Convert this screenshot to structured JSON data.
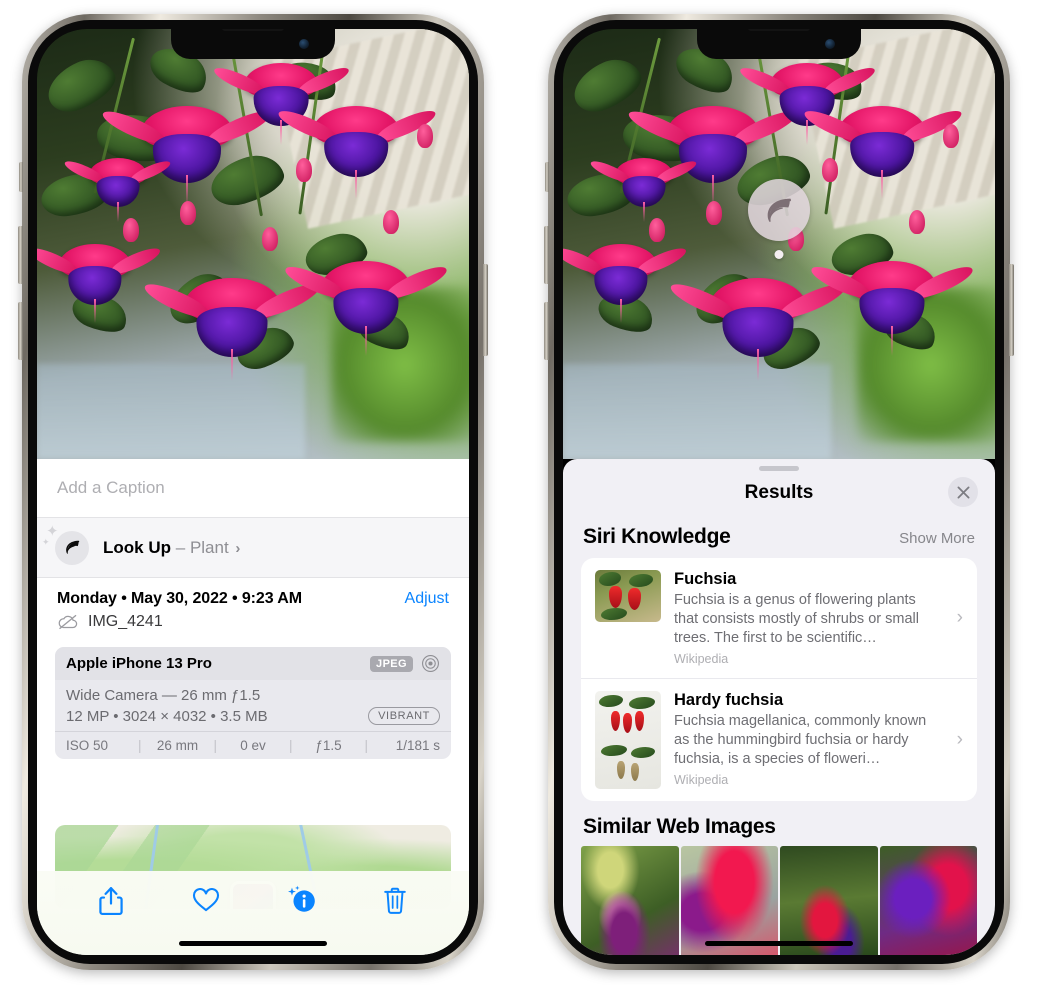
{
  "left_phone": {
    "caption_placeholder": "Add a Caption",
    "lookup": {
      "label": "Look Up",
      "dash": "–",
      "subject": "Plant",
      "chevron": "›",
      "icon": "leaf-icon"
    },
    "metadata": {
      "date_line": "Monday • May 30, 2022 • 9:23 AM",
      "adjust_label": "Adjust",
      "filename": "IMG_4241",
      "cloud_icon": "cloud-slash-icon"
    },
    "exif": {
      "device": "Apple iPhone 13 Pro",
      "format_badge": "JPEG",
      "aperture_icon": "aperture-icon",
      "lens_line": "Wide Camera — 26 mm ƒ1.5",
      "size_line": "12 MP • 3024 × 4032 • 3.5 MB",
      "style_badge": "VIBRANT",
      "stats": [
        "ISO 50",
        "26 mm",
        "0 ev",
        "ƒ1.5",
        "1/181 s"
      ],
      "divider": "|"
    },
    "toolbar": {
      "share_label": "Share",
      "favorite_label": "Favorite",
      "info_label": "Info",
      "delete_label": "Delete"
    }
  },
  "right_phone": {
    "badge_icon": "leaf-icon",
    "sheet": {
      "title": "Results",
      "close_icon": "close-icon",
      "sections": [
        {
          "title": "Siri Knowledge",
          "action": "Show More",
          "items": [
            {
              "title": "Fuchsia",
              "description": "Fuchsia is a genus of flowering plants that consists mostly of shrubs or small trees. The first to be scientific…",
              "source": "Wikipedia",
              "chevron": "›"
            },
            {
              "title": "Hardy fuchsia",
              "description": "Fuchsia magellanica, commonly known as the hummingbird fuchsia or hardy fuchsia, is a species of floweri…",
              "source": "Wikipedia",
              "chevron": "›"
            }
          ]
        },
        {
          "title": "Similar Web Images",
          "action": "",
          "thumbnails": [
            "web-image-1",
            "web-image-2",
            "web-image-3",
            "web-image-4"
          ]
        }
      ]
    }
  },
  "colors": {
    "accent_blue": "#0a84ff",
    "sheet_background": "#f1f0f5",
    "card_background": "#ffffff",
    "secondary_text": "#8e8e93",
    "exif_panel": "#e9e9ee"
  }
}
